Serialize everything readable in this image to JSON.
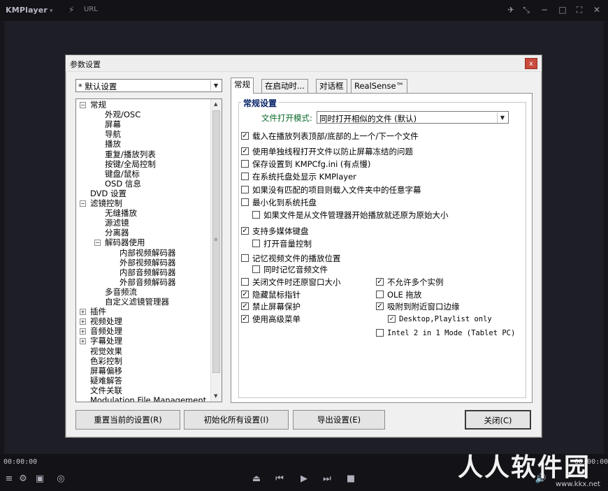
{
  "app": {
    "name": "KMPlayer",
    "url_label": "URL",
    "time_left": "00:00:00",
    "time_right": "00:00:00"
  },
  "watermark": {
    "main": "人人软件园",
    "sub": "www.kkx.net"
  },
  "dialog": {
    "title": "参数设置",
    "close_glyph": "x",
    "preset": "* 默认设置",
    "tree": [
      {
        "label": "常规",
        "level": 0,
        "expander": "−"
      },
      {
        "label": "外观/OSC",
        "level": 1
      },
      {
        "label": "屏幕",
        "level": 1
      },
      {
        "label": "导航",
        "level": 1
      },
      {
        "label": "播放",
        "level": 1
      },
      {
        "label": "重复/播放列表",
        "level": 1
      },
      {
        "label": "按键/全局控制",
        "level": 1
      },
      {
        "label": "键盘/鼠标",
        "level": 1
      },
      {
        "label": "OSD 信息",
        "level": 1
      },
      {
        "label": "DVD 设置",
        "level": 0
      },
      {
        "label": "滤镜控制",
        "level": 0,
        "expander": "−"
      },
      {
        "label": "无缝播放",
        "level": 1
      },
      {
        "label": "源滤镜",
        "level": 1
      },
      {
        "label": "分离器",
        "level": 1
      },
      {
        "label": "解码器使用",
        "level": 1,
        "expander": "−"
      },
      {
        "label": "内部视频解码器",
        "level": 2
      },
      {
        "label": "外部视频解码器",
        "level": 2
      },
      {
        "label": "内部音频解码器",
        "level": 2
      },
      {
        "label": "外部音频解码器",
        "level": 2
      },
      {
        "label": "多音频流",
        "level": 1
      },
      {
        "label": "自定义滤镜管理器",
        "level": 1
      },
      {
        "label": "插件",
        "level": 0,
        "expander": "+"
      },
      {
        "label": "视频处理",
        "level": 0,
        "expander": "+"
      },
      {
        "label": "音频处理",
        "level": 0,
        "expander": "+"
      },
      {
        "label": "字幕处理",
        "level": 0,
        "expander": "+"
      },
      {
        "label": "视觉效果",
        "level": 0
      },
      {
        "label": "色彩控制",
        "level": 0
      },
      {
        "label": "屏幕偏移",
        "level": 0
      },
      {
        "label": "疑难解答",
        "level": 0
      },
      {
        "label": "文件关联",
        "level": 0
      },
      {
        "label": "Modulation File Management",
        "level": 0
      }
    ],
    "tabs": [
      "常规",
      "在启动时...",
      "对话框",
      "RealSense™"
    ],
    "group_title": "常规设置",
    "open_mode_label": "文件打开模式:",
    "open_mode_value": "同时打开相似的文件 (默认)",
    "options": [
      {
        "label": "载入在播放列表顶部/底部的上一个/下一个文件",
        "checked": true
      },
      {
        "label": "使用单独线程打开文件以防止屏幕冻结的问题",
        "checked": true
      },
      {
        "label": "保存设置到 KMPCfg.ini (有点慢)",
        "checked": false
      },
      {
        "label": "在系统托盘处显示 KMPlayer",
        "checked": false
      },
      {
        "label": "如果没有匹配的项目则载入文件夹中的任意字幕",
        "checked": false
      },
      {
        "label": "最小化到系统托盘",
        "checked": false
      },
      {
        "label": "如果文件是从文件管理器开始播放就还原为原始大小",
        "checked": false
      },
      {
        "label": "支持多媒体键盘",
        "checked": true
      },
      {
        "label": "打开音量控制",
        "checked": false
      },
      {
        "label": "记忆视频文件的播放位置",
        "checked": false
      },
      {
        "label": "同时记忆音频文件",
        "checked": false
      },
      {
        "label": "关闭文件时还原窗口大小",
        "checked": false
      },
      {
        "label": "隐藏鼠标指针",
        "checked": true
      },
      {
        "label": "禁止屏幕保护",
        "checked": true
      },
      {
        "label": "使用高级菜单",
        "checked": true
      },
      {
        "label": "不允许多个实例",
        "checked": true
      },
      {
        "label": "OLE 拖放",
        "checked": false
      },
      {
        "label": "吸附到附近窗口边缘",
        "checked": true
      },
      {
        "label": "Desktop,Playlist only",
        "checked": true
      },
      {
        "label": "Intel 2 in 1 Mode (Tablet PC)",
        "checked": false
      }
    ],
    "buttons": {
      "reset": "重置当前的设置(R)",
      "init": "初始化所有设置(I)",
      "export": "导出设置(E)",
      "close": "关闭(C)"
    }
  }
}
